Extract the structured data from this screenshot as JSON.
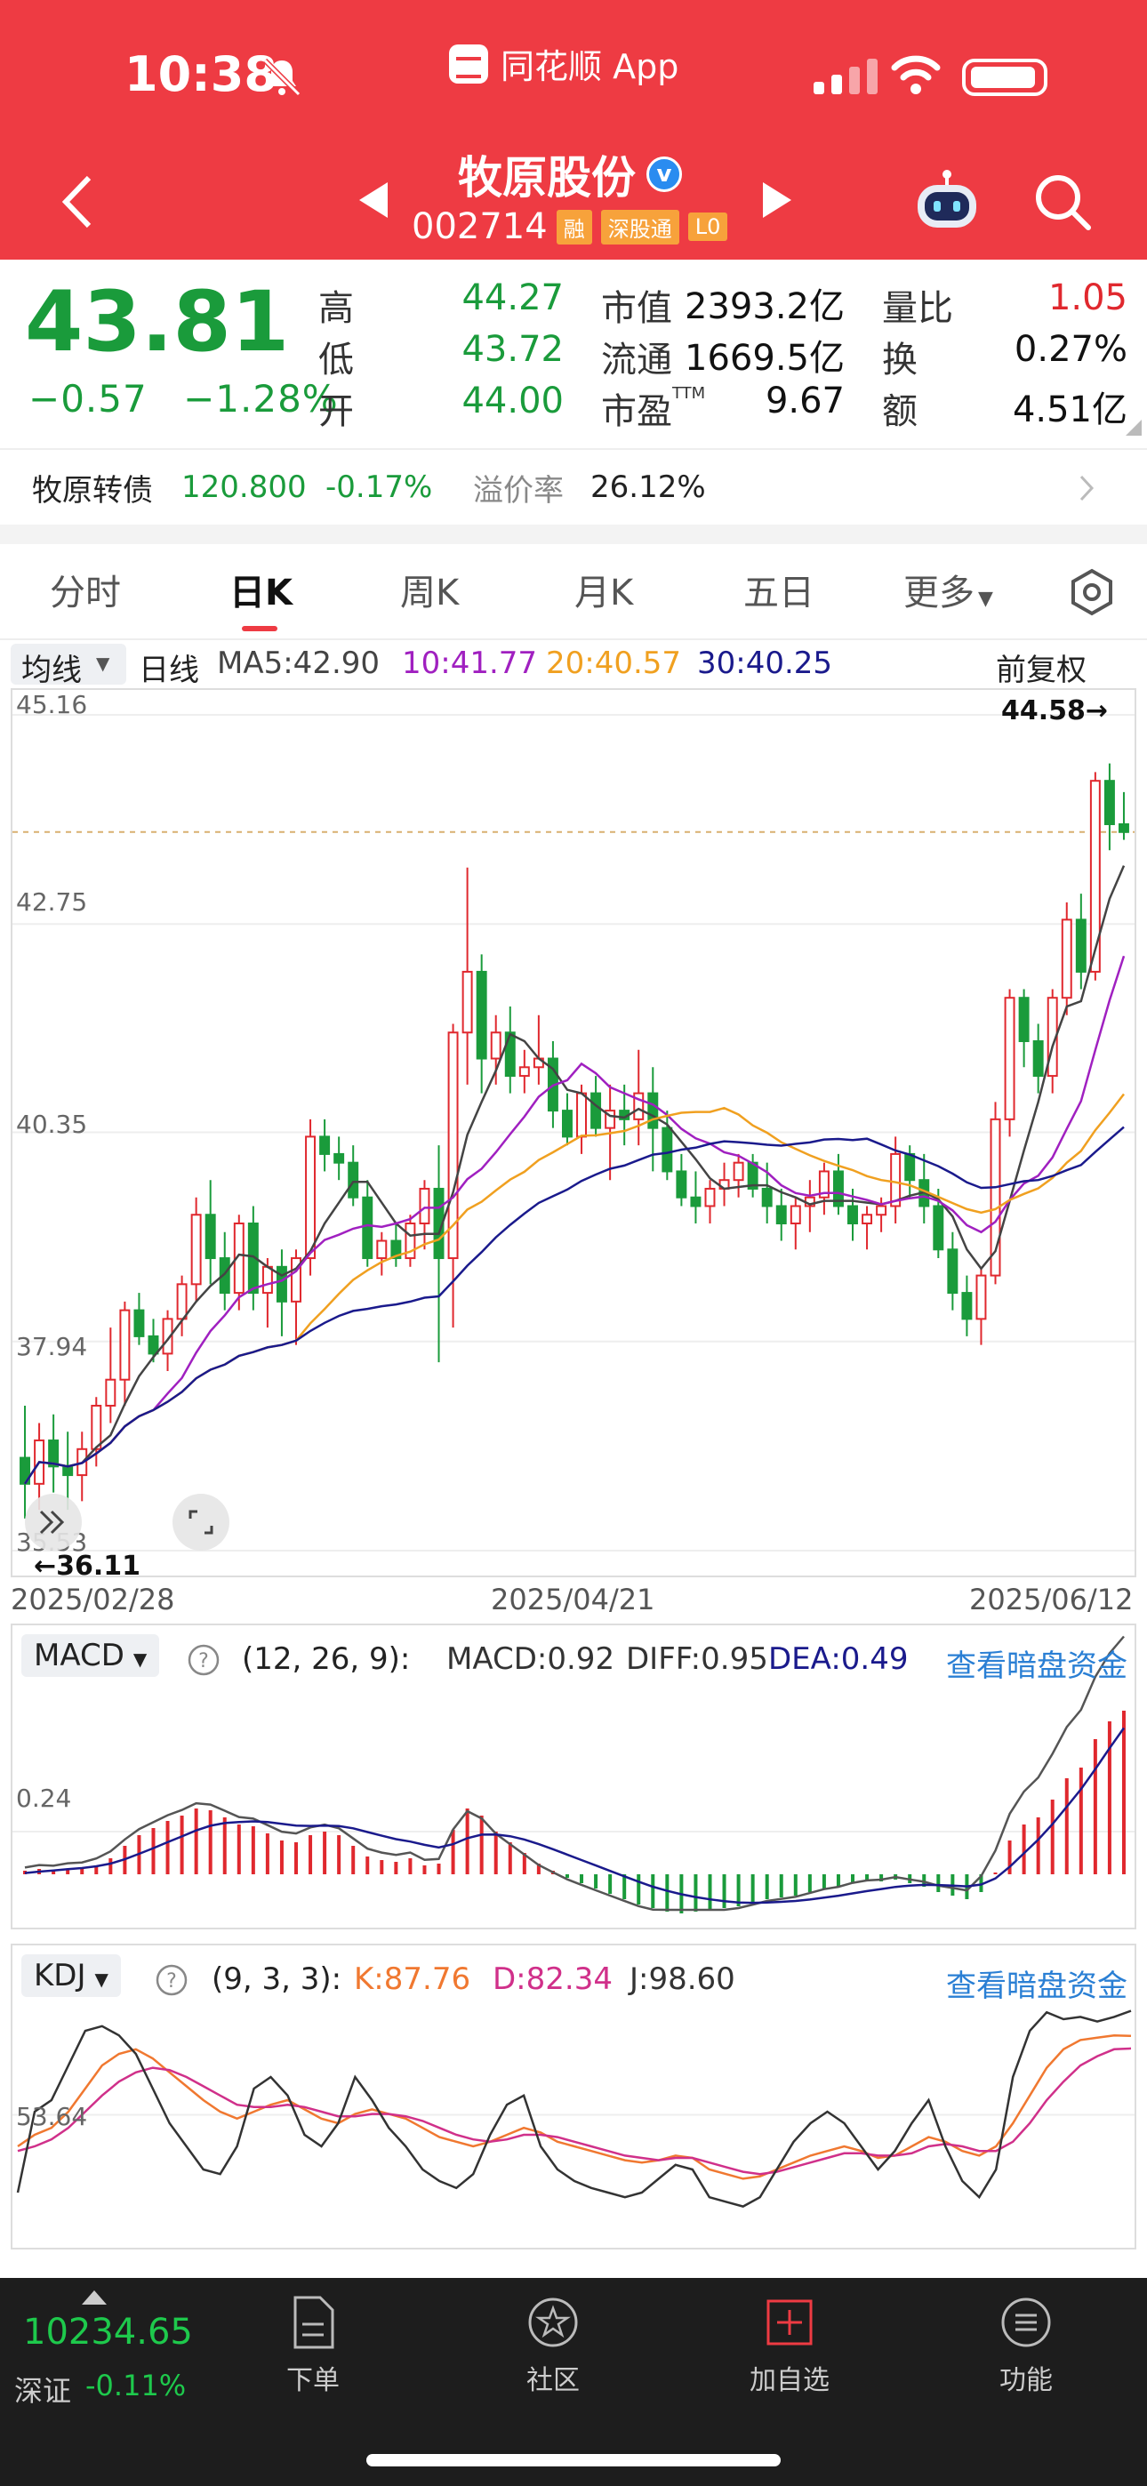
{
  "status": {
    "time": "10:38",
    "app_name": "同花顺 App"
  },
  "header": {
    "stock_name": "牧原股份",
    "verified": "v",
    "code": "002714",
    "tags": [
      "融",
      "深股通",
      "L0"
    ]
  },
  "quote": {
    "price": "43.81",
    "change": "−0.57",
    "change_pct": "−1.28%",
    "high_label": "高",
    "high": "44.27",
    "low_label": "低",
    "low": "43.72",
    "open_label": "开",
    "open": "44.00",
    "mcap_label": "市值",
    "mcap": "2393.2亿",
    "float_label": "流通",
    "float": "1669.5亿",
    "pe_label": "市盈",
    "pe_sup": "TTM",
    "pe": "9.67",
    "vr_label": "量比",
    "vr": "1.05",
    "turnover_label": "换",
    "turnover": "0.27%",
    "amount_label": "额",
    "amount": "4.51亿"
  },
  "bond": {
    "name": "牧原转债",
    "price": "120.800",
    "change": "-0.17%",
    "premium_label": "溢价率",
    "premium": "26.12%"
  },
  "tabs": [
    "分时",
    "日K",
    "周K",
    "月K",
    "五日",
    "更多"
  ],
  "ma_bar": {
    "selector": "均线",
    "period": "日线",
    "ma5": "MA5:42.90",
    "ma10": "10:41.77",
    "ma20": "20:40.57",
    "ma30": "30:40.25",
    "adjust": "前复权"
  },
  "kline": {
    "y_labels": [
      "45.16",
      "42.75",
      "40.35",
      "37.94",
      "35.53"
    ],
    "dates": [
      "2025/02/28",
      "2025/04/21",
      "2025/06/12"
    ],
    "max_marker": "44.58→",
    "min_marker": "←36.11"
  },
  "macd": {
    "selector": "MACD",
    "params": "(12, 26, 9):",
    "macd": "MACD:0.92",
    "diff": "DIFF:0.95",
    "dea": "DEA:0.49",
    "link": "查看暗盘资金",
    "y_label": "0.24"
  },
  "kdj": {
    "selector": "KDJ",
    "params": "(9, 3, 3):",
    "k": "K:87.76",
    "d": "D:82.34",
    "j": "J:98.60",
    "link": "查看暗盘资金",
    "y_label": "53.64"
  },
  "colors": {
    "up": "#e0282e",
    "down": "#1a9b3b",
    "ma5": "#444444",
    "ma10": "#a020c0",
    "ma20": "#f0a020",
    "ma30": "#1a1a8c"
  },
  "bottom": {
    "index_value": "10234.65",
    "index_name": "深证",
    "index_change": "-0.11%",
    "nav": [
      "下单",
      "社区",
      "加自选",
      "功能"
    ]
  },
  "chart_data": [
    {
      "type": "candlestick",
      "title": "牧原股份 日K",
      "x_range": [
        "2025/02/28",
        "2025/06/12"
      ],
      "ylim": [
        35.53,
        45.16
      ],
      "ohlc": [
        [
          36.6,
          37.2,
          35.9,
          36.3
        ],
        [
          36.3,
          37.0,
          36.0,
          36.8
        ],
        [
          36.8,
          37.1,
          36.2,
          36.5
        ],
        [
          36.5,
          36.9,
          36.0,
          36.4
        ],
        [
          36.4,
          36.9,
          36.1,
          36.7
        ],
        [
          36.7,
          37.3,
          36.5,
          37.2
        ],
        [
          37.2,
          38.1,
          37.0,
          37.5
        ],
        [
          37.5,
          38.4,
          37.2,
          38.3
        ],
        [
          38.3,
          38.5,
          37.9,
          38.0
        ],
        [
          38.0,
          38.2,
          37.7,
          37.8
        ],
        [
          37.8,
          38.3,
          37.6,
          38.2
        ],
        [
          38.2,
          38.7,
          38.0,
          38.6
        ],
        [
          38.6,
          39.6,
          38.4,
          39.4
        ],
        [
          39.4,
          39.8,
          38.6,
          38.9
        ],
        [
          38.9,
          39.2,
          38.3,
          38.5
        ],
        [
          38.5,
          39.4,
          38.3,
          39.3
        ],
        [
          39.3,
          39.5,
          38.3,
          38.5
        ],
        [
          38.5,
          38.9,
          38.1,
          38.8
        ],
        [
          38.8,
          39.0,
          38.0,
          38.4
        ],
        [
          38.4,
          39.0,
          37.9,
          38.9
        ],
        [
          38.9,
          40.5,
          38.7,
          40.3
        ],
        [
          40.3,
          40.5,
          39.9,
          40.1
        ],
        [
          40.1,
          40.3,
          39.8,
          40.0
        ],
        [
          40.0,
          40.2,
          39.5,
          39.6
        ],
        [
          39.6,
          39.8,
          38.8,
          38.9
        ],
        [
          38.9,
          39.2,
          38.7,
          39.1
        ],
        [
          39.1,
          39.3,
          38.8,
          38.9
        ],
        [
          38.9,
          39.4,
          38.8,
          39.3
        ],
        [
          39.3,
          39.8,
          39.0,
          39.7
        ],
        [
          39.7,
          40.2,
          37.7,
          38.9
        ],
        [
          38.9,
          41.6,
          38.1,
          41.5
        ],
        [
          41.5,
          43.4,
          40.9,
          42.2
        ],
        [
          42.2,
          42.4,
          40.8,
          41.2
        ],
        [
          41.2,
          41.7,
          40.9,
          41.5
        ],
        [
          41.5,
          41.8,
          40.8,
          41.0
        ],
        [
          41.0,
          41.3,
          40.8,
          41.1
        ],
        [
          41.1,
          41.7,
          40.9,
          41.2
        ],
        [
          41.2,
          41.4,
          40.4,
          40.6
        ],
        [
          40.6,
          40.8,
          40.2,
          40.3
        ],
        [
          40.3,
          40.9,
          40.1,
          40.8
        ],
        [
          40.8,
          41.0,
          40.3,
          40.4
        ],
        [
          40.4,
          40.9,
          39.8,
          40.6
        ],
        [
          40.6,
          40.9,
          40.2,
          40.5
        ],
        [
          40.5,
          41.3,
          40.2,
          40.8
        ],
        [
          40.8,
          41.1,
          39.9,
          40.4
        ],
        [
          40.4,
          40.6,
          39.8,
          39.9
        ],
        [
          39.9,
          40.1,
          39.5,
          39.6
        ],
        [
          39.6,
          39.9,
          39.3,
          39.5
        ],
        [
          39.5,
          39.8,
          39.3,
          39.7
        ],
        [
          39.7,
          40.0,
          39.5,
          39.8
        ],
        [
          39.8,
          40.1,
          39.6,
          40.0
        ],
        [
          40.0,
          40.1,
          39.6,
          39.7
        ],
        [
          39.7,
          40.0,
          39.3,
          39.5
        ],
        [
          39.5,
          39.7,
          39.1,
          39.3
        ],
        [
          39.3,
          39.6,
          39.0,
          39.5
        ],
        [
          39.5,
          39.8,
          39.2,
          39.6
        ],
        [
          39.6,
          40.0,
          39.4,
          39.9
        ],
        [
          39.9,
          40.1,
          39.4,
          39.5
        ],
        [
          39.5,
          39.7,
          39.1,
          39.3
        ],
        [
          39.3,
          39.5,
          39.0,
          39.4
        ],
        [
          39.4,
          39.6,
          39.2,
          39.5
        ],
        [
          39.5,
          40.3,
          39.3,
          40.1
        ],
        [
          40.1,
          40.2,
          39.6,
          39.8
        ],
        [
          39.8,
          40.1,
          39.3,
          39.5
        ],
        [
          39.5,
          39.7,
          38.9,
          39.0
        ],
        [
          39.0,
          39.2,
          38.3,
          38.5
        ],
        [
          38.5,
          38.7,
          38.0,
          38.2
        ],
        [
          38.2,
          38.8,
          37.9,
          38.7
        ],
        [
          38.7,
          40.7,
          38.6,
          40.5
        ],
        [
          40.5,
          42.0,
          40.3,
          41.9
        ],
        [
          41.9,
          42.0,
          41.1,
          41.4
        ],
        [
          41.4,
          41.6,
          40.8,
          41.0
        ],
        [
          41.0,
          42.0,
          40.8,
          41.9
        ],
        [
          41.9,
          43.0,
          41.7,
          42.8
        ],
        [
          42.8,
          43.1,
          42.0,
          42.2
        ],
        [
          42.2,
          44.5,
          42.1,
          44.4
        ],
        [
          44.4,
          44.6,
          43.6,
          43.9
        ],
        [
          43.9,
          44.27,
          43.72,
          43.81
        ]
      ]
    },
    {
      "type": "bar",
      "title": "MACD (12, 26, 9)",
      "values": [
        0.02,
        0.03,
        0.02,
        0.03,
        0.03,
        0.05,
        0.09,
        0.16,
        0.22,
        0.26,
        0.3,
        0.33,
        0.37,
        0.36,
        0.32,
        0.28,
        0.27,
        0.23,
        0.19,
        0.18,
        0.22,
        0.24,
        0.22,
        0.16,
        0.1,
        0.08,
        0.07,
        0.09,
        0.05,
        0.06,
        0.25,
        0.37,
        0.33,
        0.24,
        0.18,
        0.12,
        0.06,
        0.02,
        -0.02,
        -0.05,
        -0.08,
        -0.11,
        -0.14,
        -0.17,
        -0.19,
        -0.21,
        -0.22,
        -0.21,
        -0.2,
        -0.19,
        -0.18,
        -0.16,
        -0.14,
        -0.13,
        -0.12,
        -0.1,
        -0.08,
        -0.07,
        -0.05,
        -0.04,
        -0.04,
        -0.03,
        -0.05,
        -0.07,
        -0.1,
        -0.12,
        -0.14,
        -0.1,
        0.01,
        0.19,
        0.28,
        0.32,
        0.42,
        0.54,
        0.6,
        0.76,
        0.86,
        0.92
      ]
    },
    {
      "type": "line",
      "title": "KDJ (9, 3, 3)",
      "series": [
        {
          "name": "K",
          "values": [
            40,
            45,
            48,
            55,
            65,
            75,
            80,
            82,
            78,
            72,
            66,
            60,
            55,
            52,
            55,
            58,
            60,
            56,
            52,
            50,
            54,
            56,
            54,
            52,
            48,
            44,
            42,
            40,
            42,
            45,
            48,
            46,
            42,
            40,
            38,
            36,
            34,
            33,
            34,
            36,
            35,
            30,
            28,
            26,
            27,
            30,
            33,
            36,
            38,
            40,
            38,
            35,
            36,
            40,
            44,
            42,
            38,
            36,
            40,
            50,
            62,
            74,
            82,
            86,
            87,
            88,
            87.76
          ]
        },
        {
          "name": "D",
          "values": [
            38,
            40,
            43,
            48,
            55,
            62,
            68,
            72,
            74,
            73,
            70,
            66,
            62,
            58,
            57,
            57,
            58,
            57,
            55,
            53,
            53,
            54,
            54,
            53,
            51,
            48,
            45,
            43,
            42,
            43,
            45,
            45,
            44,
            42,
            40,
            38,
            36,
            35,
            34,
            35,
            35,
            33,
            31,
            29,
            28,
            29,
            31,
            33,
            35,
            37,
            37,
            36,
            36,
            37,
            40,
            41,
            40,
            38,
            38,
            42,
            50,
            60,
            68,
            75,
            79,
            82,
            82.34
          ]
        },
        {
          "name": "J",
          "values": [
            20,
            55,
            60,
            75,
            90,
            92,
            88,
            80,
            65,
            50,
            40,
            30,
            28,
            40,
            65,
            70,
            62,
            45,
            40,
            50,
            70,
            60,
            48,
            40,
            30,
            25,
            22,
            28,
            45,
            58,
            62,
            40,
            30,
            25,
            22,
            20,
            18,
            20,
            26,
            32,
            30,
            18,
            16,
            14,
            18,
            30,
            42,
            50,
            55,
            50,
            40,
            30,
            38,
            50,
            60,
            40,
            25,
            18,
            30,
            70,
            90,
            98,
            95,
            96,
            94,
            96,
            98.6
          ]
        }
      ]
    }
  ]
}
